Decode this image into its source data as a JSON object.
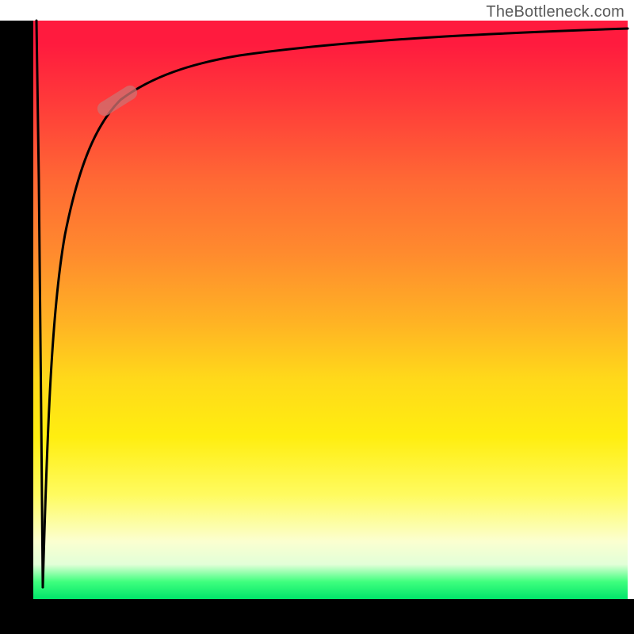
{
  "watermark": "TheBottleneck.com",
  "colors": {
    "axis": "#000000",
    "curve": "#000000",
    "segment": "#d07070",
    "gradient_top": "#ff1b3e",
    "gradient_bottom": "#00e56a"
  },
  "chart_data": {
    "type": "line",
    "title": "",
    "xlabel": "",
    "ylabel": "",
    "xlim": [
      0,
      100
    ],
    "ylim": [
      0,
      100
    ],
    "legend": false,
    "grid": false,
    "background": "gradient (red top → green bottom)",
    "annotations": [
      {
        "name": "highlighted-segment",
        "x": 14,
        "y": 86,
        "shape": "rounded-pill",
        "color": "#d07070"
      }
    ],
    "series": [
      {
        "name": "initial-drop",
        "x": [
          0.5,
          0.9,
          1.3,
          1.5
        ],
        "values": [
          100,
          60,
          20,
          2
        ]
      },
      {
        "name": "saturating-curve",
        "x": [
          1.5,
          3,
          5,
          8,
          12,
          16,
          22,
          30,
          40,
          55,
          70,
          85,
          100
        ],
        "values": [
          2,
          40,
          63,
          76,
          83,
          87,
          90,
          92.5,
          94,
          95.5,
          96.5,
          97.2,
          98
        ]
      }
    ]
  }
}
